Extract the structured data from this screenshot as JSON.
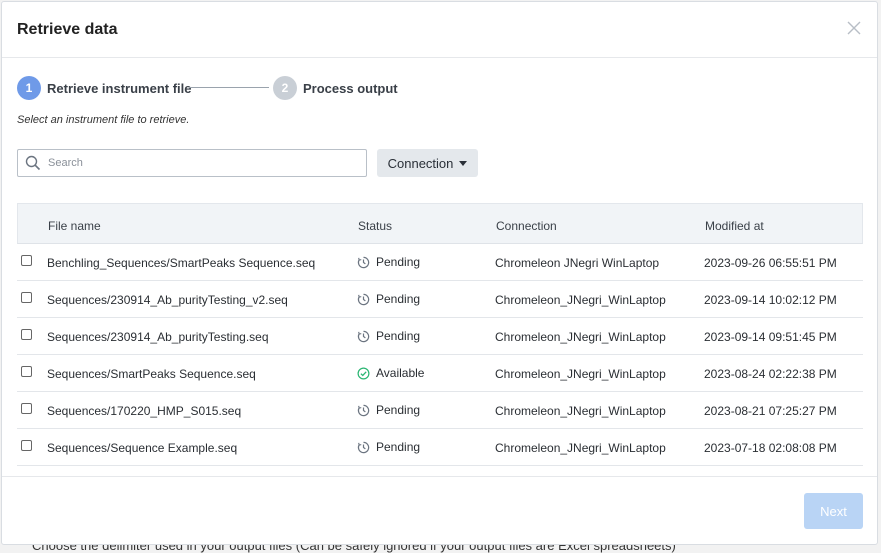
{
  "background_hint": "Choose the delimiter used in your output files (Can be safely ignored if your output files are Excel spreadsheets)",
  "modal": {
    "title": "Retrieve data",
    "close_icon": "close-icon"
  },
  "stepper": {
    "steps": [
      {
        "number": "1",
        "label": "Retrieve instrument file",
        "active": true
      },
      {
        "number": "2",
        "label": "Process output",
        "active": false
      }
    ]
  },
  "instruction": "Select an instrument file to retrieve.",
  "search": {
    "placeholder": "Search",
    "value": "",
    "icon": "search-icon"
  },
  "connection_button": {
    "label": "Connection",
    "icon": "caret-down-icon"
  },
  "table": {
    "headers": {
      "file_name": "File name",
      "status": "Status",
      "connection": "Connection",
      "modified_at": "Modified at"
    },
    "rows": [
      {
        "file_name": "Benchling_Sequences/SmartPeaks Sequence.seq",
        "status": "Pending",
        "connection": "Chromeleon JNegri WinLaptop",
        "modified_at": "2023-09-26 06:55:51 PM"
      },
      {
        "file_name": "Sequences/230914_Ab_purityTesting_v2.seq",
        "status": "Pending",
        "connection": "Chromeleon_JNegri_WinLaptop",
        "modified_at": "2023-09-14 10:02:12 PM"
      },
      {
        "file_name": "Sequences/230914_Ab_purityTesting.seq",
        "status": "Pending",
        "connection": "Chromeleon_JNegri_WinLaptop",
        "modified_at": "2023-09-14 09:51:45 PM"
      },
      {
        "file_name": "Sequences/SmartPeaks Sequence.seq",
        "status": "Available",
        "connection": "Chromeleon_JNegri_WinLaptop",
        "modified_at": "2023-08-24 02:22:38 PM"
      },
      {
        "file_name": "Sequences/170220_HMP_S015.seq",
        "status": "Pending",
        "connection": "Chromeleon_JNegri_WinLaptop",
        "modified_at": "2023-08-21 07:25:27 PM"
      },
      {
        "file_name": "Sequences/Sequence Example.seq",
        "status": "Pending",
        "connection": "Chromeleon_JNegri_WinLaptop",
        "modified_at": "2023-07-18 02:08:08 PM"
      }
    ]
  },
  "footer": {
    "next_label": "Next"
  },
  "colors": {
    "accent": "#6f9ae8",
    "next_disabled": "#b9d4f5",
    "available": "#2bb673",
    "pending": "#6b7480"
  }
}
